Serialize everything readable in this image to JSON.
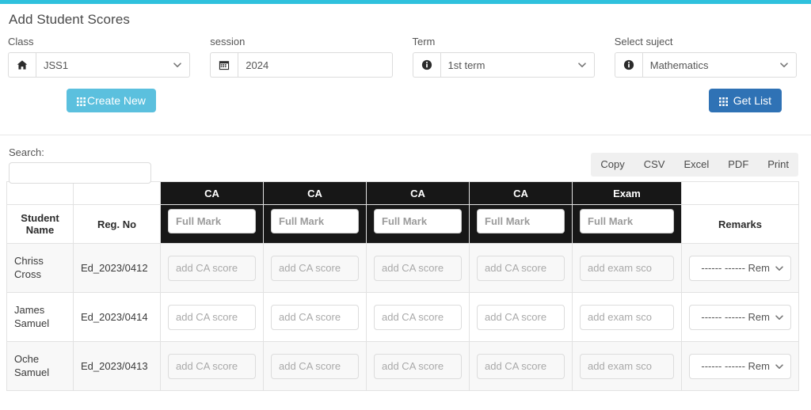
{
  "accent_color": "#2fc1dd",
  "page_title": "Add Student Scores",
  "form": {
    "class": {
      "label": "Class",
      "icon": "home-icon",
      "value": "JSS1"
    },
    "session": {
      "label": "session",
      "icon": "calendar-icon",
      "value": "2024"
    },
    "term": {
      "label": "Term",
      "icon": "info-circle-icon",
      "value": "1st term"
    },
    "subject": {
      "label": "Select suject",
      "icon": "info-circle-icon",
      "value": "Mathematics"
    },
    "create_new_label": "Create New",
    "create_new_color": "#5bc0de",
    "get_list_label": "Get List",
    "get_list_color": "#2f72b5"
  },
  "toolbar": {
    "search_label": "Search:",
    "search_value": "",
    "search_placeholder": "",
    "export_buttons": [
      "Copy",
      "CSV",
      "Excel",
      "PDF",
      "Print"
    ]
  },
  "table": {
    "group_headers": [
      "CA",
      "CA",
      "CA",
      "CA",
      "Exam"
    ],
    "columns": {
      "student_name": "Student\nName",
      "student_name_line1": "Student",
      "student_name_line2": "Name",
      "reg_no": "Reg. No",
      "remarks": "Remarks"
    },
    "full_mark_placeholder": "Full Mark",
    "full_mark_values": [
      "",
      "",
      "",
      "",
      ""
    ],
    "ca_score_placeholder": "add CA score",
    "exam_score_placeholder": "add exam sco",
    "remark_selected": "------ ------ Rem",
    "rows": [
      {
        "name_line1": "Chriss",
        "name_line2": "Cross",
        "reg_no": "Ed_2023/0412",
        "ca": [
          "",
          "",
          "",
          ""
        ],
        "exam": "",
        "remark": "------ ------ Rem"
      },
      {
        "name_line1": "James",
        "name_line2": "Samuel",
        "reg_no": "Ed_2023/0414",
        "ca": [
          "",
          "",
          "",
          ""
        ],
        "exam": "",
        "remark": "------ ------ Rem"
      },
      {
        "name_line1": "Oche",
        "name_line2": "Samuel",
        "reg_no": "Ed_2023/0413",
        "ca": [
          "",
          "",
          "",
          ""
        ],
        "exam": "",
        "remark": "------ ------ Rem"
      }
    ]
  }
}
